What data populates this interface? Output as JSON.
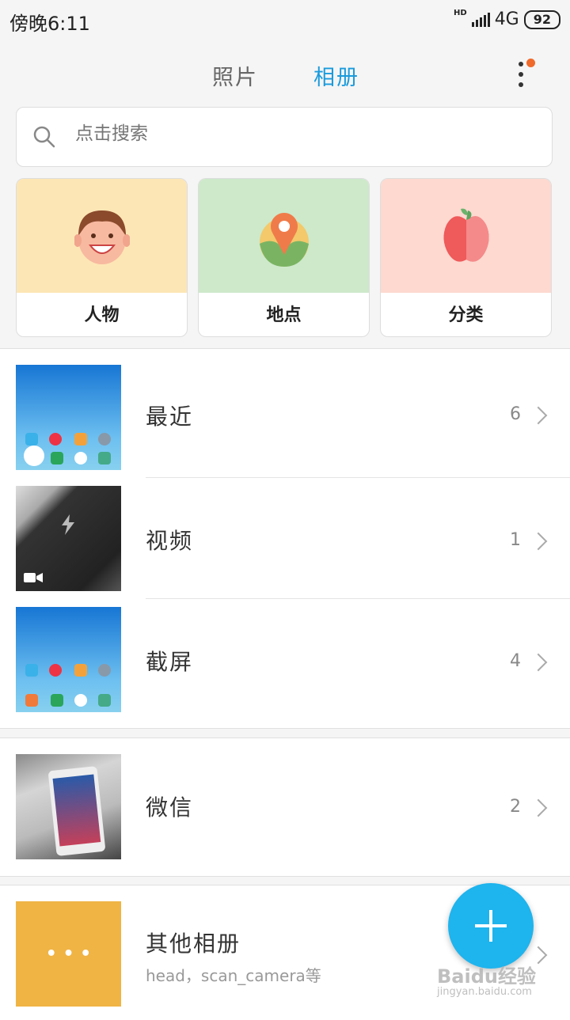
{
  "status": {
    "time": "傍晚6:11",
    "hd": "HD",
    "network": "4G",
    "battery": "92"
  },
  "tabs": [
    {
      "label": "照片"
    },
    {
      "label": "相册"
    }
  ],
  "search": {
    "placeholder": "点击搜索"
  },
  "categories": [
    {
      "label": "人物"
    },
    {
      "label": "地点"
    },
    {
      "label": "分类"
    }
  ],
  "albums": [
    {
      "title": "最近",
      "count": "6"
    },
    {
      "title": "视频",
      "count": "1"
    },
    {
      "title": "截屏",
      "count": "4"
    },
    {
      "title": "微信",
      "count": "2"
    },
    {
      "title": "其他相册",
      "subtitle": "head，scan_camera等",
      "thumb_text": "• • •"
    }
  ],
  "watermark": {
    "brand": "Baidu经验",
    "url": "jingyan.baidu.com"
  },
  "colors": {
    "accent": "#1a9bdc",
    "fab": "#1eb4ee",
    "other_album": "#f0b445"
  }
}
